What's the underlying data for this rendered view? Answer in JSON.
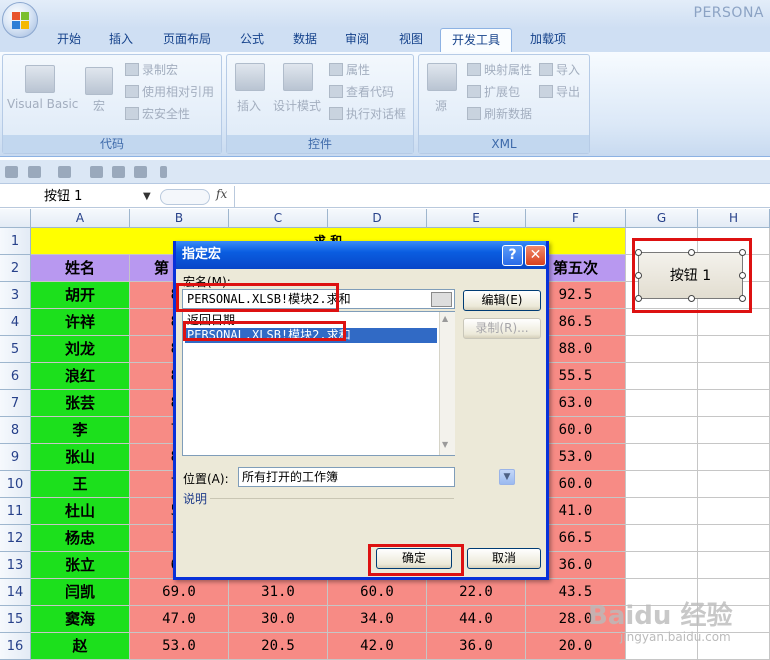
{
  "window": {
    "title_partial": "PERSONA"
  },
  "tabs": [
    "开始",
    "插入",
    "页面布局",
    "公式",
    "数据",
    "审阅",
    "视图",
    "开发工具",
    "加载项"
  ],
  "active_tab": "开发工具",
  "ribbon": {
    "groups": {
      "code": {
        "label": "代码",
        "vb": "Visual Basic",
        "macros": "宏",
        "record": "录制宏",
        "relative": "使用相对引用",
        "security": "宏安全性"
      },
      "controls": {
        "label": "控件",
        "insert": "插入",
        "design": "设计模式",
        "properties": "属性",
        "view_code": "查看代码",
        "run_dialog": "执行对话框"
      },
      "xml": {
        "label": "XML",
        "source": "源",
        "map_props": "映射属性",
        "expansion": "扩展包",
        "refresh": "刷新数据",
        "import": "导入",
        "export": "导出"
      }
    }
  },
  "formula_bar": {
    "name_box": "按钮 1",
    "fx": "fx"
  },
  "sheet": {
    "columns": [
      "A",
      "B",
      "C",
      "D",
      "E",
      "F",
      "G",
      "H"
    ],
    "rows": [
      "1",
      "2",
      "3",
      "4",
      "5",
      "6",
      "7",
      "8",
      "9",
      "10",
      "11",
      "12",
      "13",
      "14",
      "15",
      "16"
    ],
    "title": "求 和",
    "header_name": "姓名",
    "header_b_partial": "第",
    "header_f": "第五次",
    "names": [
      "胡开",
      "许祥",
      "刘龙",
      "浪红",
      "张芸",
      "李",
      "张山",
      "王",
      "杜山",
      "杨忠",
      "张立",
      "闫凯",
      "窦海",
      "赵"
    ],
    "col_b_visible": [
      "87",
      "82",
      "82",
      "86",
      "80",
      "72",
      "82",
      "73",
      "54",
      "74",
      "65",
      "69.0",
      "47.0",
      "53.0"
    ],
    "col_c": [
      "",
      "",
      "",
      "",
      "",
      "",
      "",
      "",
      "",
      "",
      "",
      "31.0",
      "30.0",
      "20.5"
    ],
    "col_d": [
      "",
      "",
      "",
      "",
      "",
      "",
      "",
      "",
      "",
      "",
      "",
      "60.0",
      "34.0",
      "42.0"
    ],
    "col_e": [
      "",
      "",
      "",
      "",
      "",
      "",
      "",
      "",
      "",
      "",
      "",
      "22.0",
      "44.0",
      "36.0"
    ],
    "col_f": [
      "92.5",
      "86.5",
      "88.0",
      "55.5",
      "63.0",
      "60.0",
      "53.0",
      "60.0",
      "41.0",
      "66.5",
      "36.0",
      "43.5",
      "28.0",
      "20.0"
    ],
    "button_label": "按钮 1"
  },
  "dialog": {
    "title": "指定宏",
    "help_glyph": "?",
    "close_glyph": "✕",
    "macro_name_label": "宏名(M):",
    "macro_name_value": "PERSONAL.XLSB!模块2.求和",
    "list_items": [
      "返回日期",
      "PERSONAL.XLSB!模块2.求和"
    ],
    "selected_index": 1,
    "edit_button": "编辑(E)",
    "record_button": "录制(R)...",
    "location_label": "位置(A):",
    "location_value": "所有打开的工作簿",
    "description_label": "说明",
    "ok_button": "确定",
    "cancel_button": "取消"
  },
  "watermark": {
    "text": "Baidu 经验",
    "sub": "jingyan.baidu.com"
  }
}
